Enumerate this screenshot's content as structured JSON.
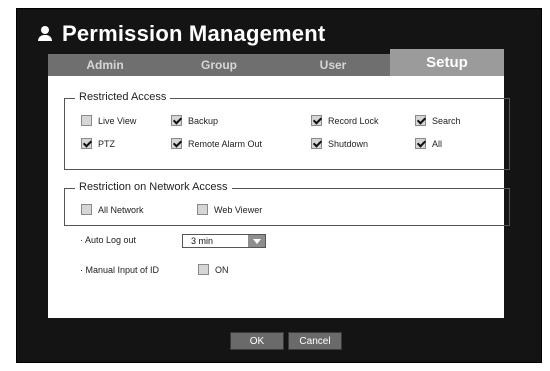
{
  "window": {
    "title": "Permission Management",
    "title_icon": "user-icon"
  },
  "tabs": [
    {
      "label": "Admin",
      "active": false
    },
    {
      "label": "Group",
      "active": false
    },
    {
      "label": "User",
      "active": false
    },
    {
      "label": "Setup",
      "active": true
    }
  ],
  "restricted_access": {
    "legend": "Restricted Access",
    "items": [
      {
        "label": "Live View",
        "checked": false
      },
      {
        "label": "Backup",
        "checked": true
      },
      {
        "label": "Record Lock",
        "checked": true
      },
      {
        "label": "Search",
        "checked": true
      },
      {
        "label": "PTZ",
        "checked": true
      },
      {
        "label": "Remote Alarm Out",
        "checked": true
      },
      {
        "label": "Shutdown",
        "checked": true
      },
      {
        "label": "All",
        "checked": true
      }
    ]
  },
  "network_access": {
    "legend": "Restriction on Network Access",
    "items": [
      {
        "label": "All Network",
        "checked": false
      },
      {
        "label": "Web Viewer",
        "checked": false
      }
    ]
  },
  "auto_logout": {
    "label": "· Auto Log out",
    "value": "3 min"
  },
  "manual_id": {
    "label": "· Manual Input of ID",
    "option_label": "ON",
    "checked": false
  },
  "buttons": {
    "ok": "OK",
    "cancel": "Cancel"
  }
}
